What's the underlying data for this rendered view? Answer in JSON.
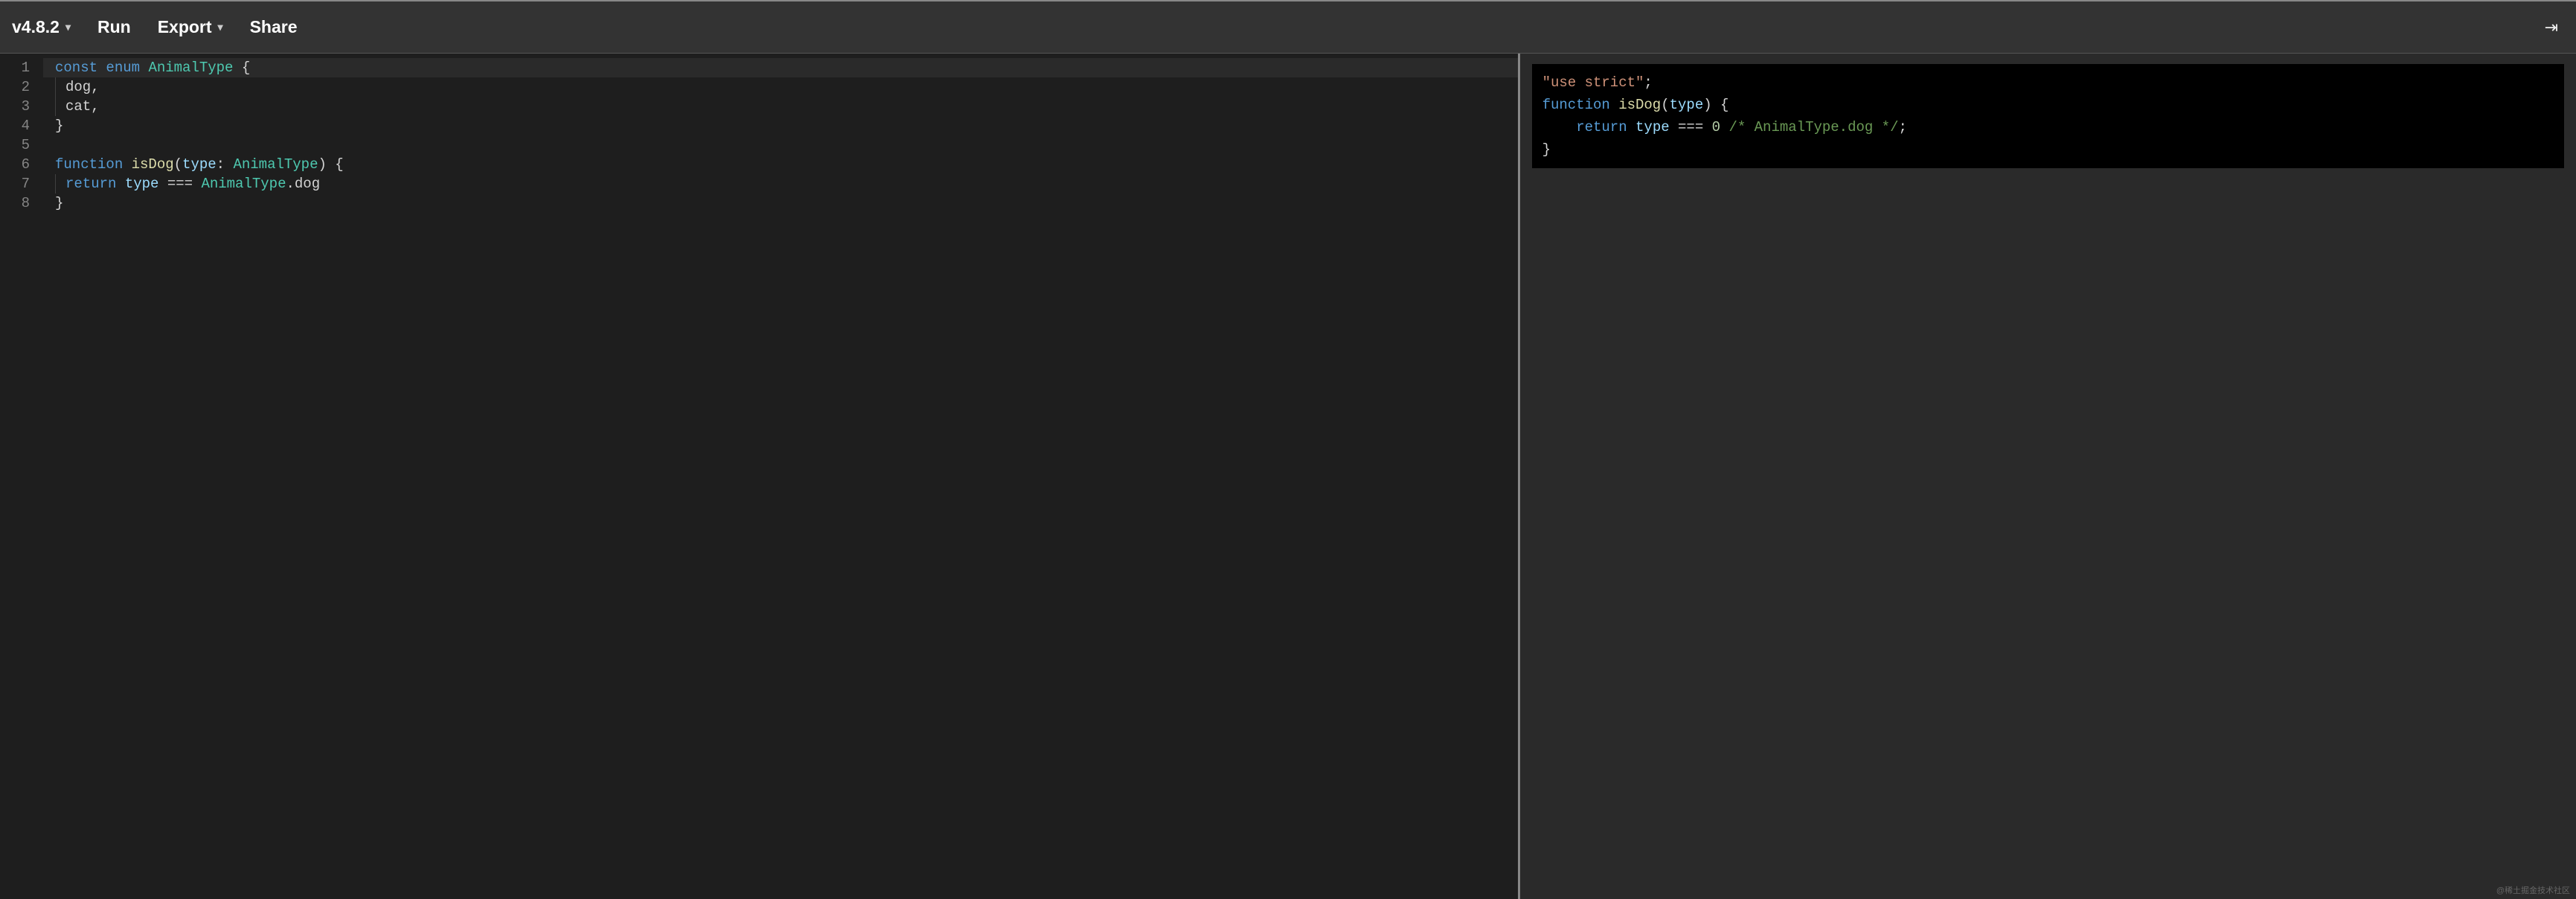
{
  "toolbar": {
    "version_label": "v4.8.2",
    "run_label": "Run",
    "export_label": "Export",
    "share_label": "Share",
    "collapse_icon": "⇥"
  },
  "editor": {
    "line_numbers": [
      "1",
      "2",
      "3",
      "4",
      "5",
      "6",
      "7",
      "8"
    ],
    "lines": [
      {
        "indent": 0,
        "tokens": [
          {
            "t": "const ",
            "c": "tk-kw"
          },
          {
            "t": "enum ",
            "c": "tk-kw"
          },
          {
            "t": "AnimalType",
            "c": "tk-type"
          },
          {
            "t": " {",
            "c": "tk-pun"
          }
        ],
        "current": true
      },
      {
        "indent": 1,
        "tokens": [
          {
            "t": "dog",
            "c": "tk-plain"
          },
          {
            "t": ",",
            "c": "tk-pun"
          }
        ]
      },
      {
        "indent": 1,
        "tokens": [
          {
            "t": "cat",
            "c": "tk-plain"
          },
          {
            "t": ",",
            "c": "tk-pun"
          }
        ]
      },
      {
        "indent": 0,
        "tokens": [
          {
            "t": "}",
            "c": "tk-pun"
          }
        ]
      },
      {
        "indent": 0,
        "tokens": []
      },
      {
        "indent": 0,
        "tokens": [
          {
            "t": "function ",
            "c": "tk-kw"
          },
          {
            "t": "isDog",
            "c": "tk-fn"
          },
          {
            "t": "(",
            "c": "tk-pun"
          },
          {
            "t": "type",
            "c": "tk-var"
          },
          {
            "t": ": ",
            "c": "tk-pun"
          },
          {
            "t": "AnimalType",
            "c": "tk-type"
          },
          {
            "t": ") {",
            "c": "tk-pun"
          }
        ]
      },
      {
        "indent": 1,
        "tokens": [
          {
            "t": "return ",
            "c": "tk-kw"
          },
          {
            "t": "type",
            "c": "tk-var"
          },
          {
            "t": " === ",
            "c": "tk-pun"
          },
          {
            "t": "AnimalType",
            "c": "tk-type"
          },
          {
            "t": ".",
            "c": "tk-pun"
          },
          {
            "t": "dog",
            "c": "tk-plain"
          }
        ]
      },
      {
        "indent": 0,
        "tokens": [
          {
            "t": "}",
            "c": "tk-pun"
          }
        ]
      }
    ]
  },
  "output": {
    "lines": [
      [
        {
          "t": "\"use strict\"",
          "c": "tk-str"
        },
        {
          "t": ";",
          "c": "tk-pun"
        }
      ],
      [
        {
          "t": "function ",
          "c": "tk-kw"
        },
        {
          "t": "isDog",
          "c": "tk-fn"
        },
        {
          "t": "(",
          "c": "tk-pun"
        },
        {
          "t": "type",
          "c": "tk-var"
        },
        {
          "t": ") {",
          "c": "tk-pun"
        }
      ],
      [
        {
          "t": "    ",
          "c": "tk-plain"
        },
        {
          "t": "return ",
          "c": "tk-kw"
        },
        {
          "t": "type",
          "c": "tk-var"
        },
        {
          "t": " === ",
          "c": "tk-pun"
        },
        {
          "t": "0",
          "c": "tk-num"
        },
        {
          "t": " ",
          "c": "tk-plain"
        },
        {
          "t": "/* AnimalType.dog */",
          "c": "tk-cmt"
        },
        {
          "t": ";",
          "c": "tk-pun"
        }
      ],
      [
        {
          "t": "}",
          "c": "tk-pun"
        }
      ]
    ]
  },
  "watermark": "@稀土掘金技术社区"
}
